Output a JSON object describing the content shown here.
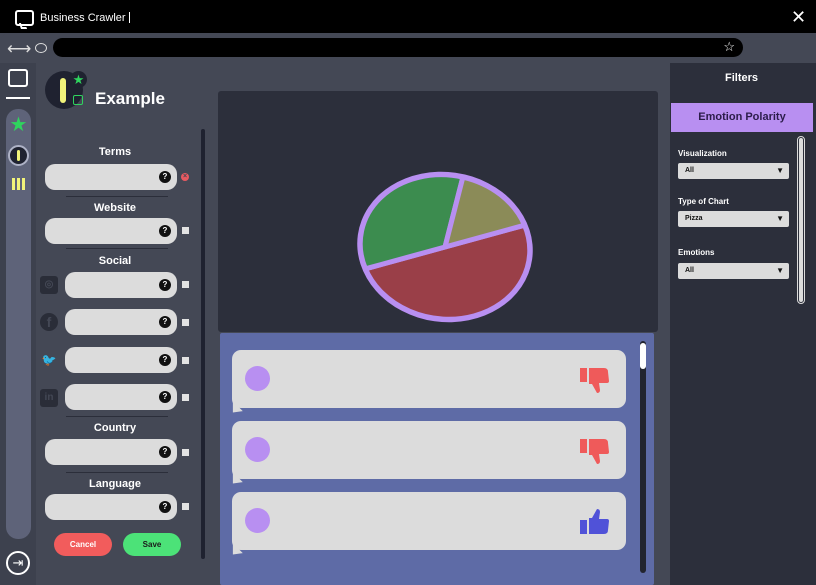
{
  "window": {
    "title": "Business Crawler",
    "close_glyph": "✕"
  },
  "addressbar": {
    "url": "",
    "nav_glyph": "⟷",
    "star_glyph": "☆"
  },
  "rail": {
    "star_glyph": "★",
    "logout_glyph": "⇥"
  },
  "project": {
    "name": "Example",
    "star_glyph": "★"
  },
  "form": {
    "sections": {
      "terms": "Terms",
      "website": "Website",
      "social": "Social",
      "country": "Country",
      "language": "Language"
    },
    "help_glyph": "?",
    "error_glyph": "×",
    "social_icons": {
      "instagram": "◎",
      "facebook": "f",
      "twitter": "🐦",
      "linkedin": "in"
    },
    "cancel_label": "Cancel",
    "save_label": "Save"
  },
  "chart_data": {
    "type": "pie",
    "slices": [
      {
        "value": 50,
        "color": "#9a3f48"
      },
      {
        "value": 34,
        "color": "#3c8c4f"
      },
      {
        "value": 16,
        "color": "#8b8b58"
      }
    ],
    "outline_color": "#b88ff1"
  },
  "comments": [
    {
      "reaction": "thumbs-down",
      "color": "#ef5a5a"
    },
    {
      "reaction": "thumbs-down",
      "color": "#ef5a5a"
    },
    {
      "reaction": "thumbs-up",
      "color": "#5052d8"
    }
  ],
  "filters": {
    "title": "Filters",
    "active_tab": "Emotion Polarity",
    "visualization": {
      "label": "Visualization",
      "value": "All"
    },
    "chart_type": {
      "label": "Type of Chart",
      "value": "Pizza"
    },
    "emotions": {
      "label": "Emotions",
      "value": "All"
    },
    "dropdown_glyph": "▼"
  },
  "colors": {
    "accent_purple": "#b88ff1",
    "accent_green": "#4ce278",
    "cancel_red": "#f25c5c",
    "panel_blue": "#5e6ba6"
  }
}
